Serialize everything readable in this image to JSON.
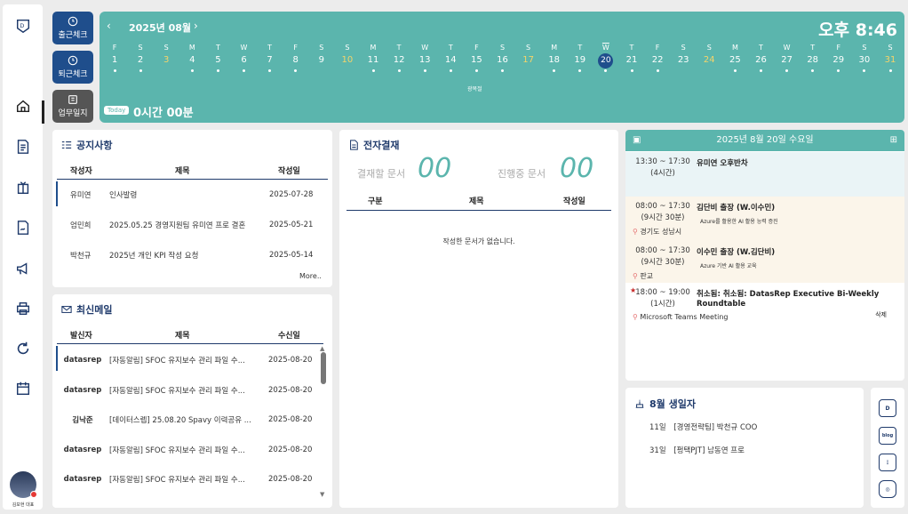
{
  "sidebar": {
    "icons": [
      "logo-icon",
      "home-icon",
      "document-icon",
      "gift-icon",
      "signature-icon",
      "megaphone-icon",
      "printer-icon",
      "refresh-icon",
      "calendar-icon"
    ],
    "user_name": "김보현 대표"
  },
  "buttons": {
    "clock_in": "출근체크",
    "clock_out": "퇴근체크",
    "work_log": "업무일지"
  },
  "calendar": {
    "month_label": "2025년 08월",
    "time": "오후 8:46",
    "today_badge": "Today",
    "today_hours": "0시간 00분",
    "holiday_label": "광복절",
    "days": [
      {
        "dow": "F",
        "num": "1",
        "dot": true
      },
      {
        "dow": "S",
        "num": "2",
        "dot": true
      },
      {
        "dow": "S",
        "num": "3",
        "dot": false,
        "weekend": true
      },
      {
        "dow": "M",
        "num": "4",
        "dot": true
      },
      {
        "dow": "T",
        "num": "5",
        "dot": true
      },
      {
        "dow": "W",
        "num": "6",
        "dot": true
      },
      {
        "dow": "T",
        "num": "7",
        "dot": true
      },
      {
        "dow": "F",
        "num": "8",
        "dot": true
      },
      {
        "dow": "S",
        "num": "9",
        "dot": false
      },
      {
        "dow": "S",
        "num": "10",
        "dot": false,
        "weekend": true
      },
      {
        "dow": "M",
        "num": "11",
        "dot": true
      },
      {
        "dow": "T",
        "num": "12",
        "dot": true
      },
      {
        "dow": "W",
        "num": "13",
        "dot": true
      },
      {
        "dow": "T",
        "num": "14",
        "dot": true
      },
      {
        "dow": "F",
        "num": "15",
        "dot": true
      },
      {
        "dow": "S",
        "num": "16",
        "dot": true
      },
      {
        "dow": "S",
        "num": "17",
        "dot": false,
        "weekend": true
      },
      {
        "dow": "M",
        "num": "18",
        "dot": true
      },
      {
        "dow": "T",
        "num": "19",
        "dot": true
      },
      {
        "dow": "W",
        "num": "20",
        "dot": true,
        "today": true
      },
      {
        "dow": "T",
        "num": "21",
        "dot": true
      },
      {
        "dow": "F",
        "num": "22",
        "dot": true
      },
      {
        "dow": "S",
        "num": "23",
        "dot": false
      },
      {
        "dow": "S",
        "num": "24",
        "dot": false,
        "weekend": true
      },
      {
        "dow": "M",
        "num": "25",
        "dot": true
      },
      {
        "dow": "T",
        "num": "26",
        "dot": true
      },
      {
        "dow": "W",
        "num": "27",
        "dot": true
      },
      {
        "dow": "T",
        "num": "28",
        "dot": true
      },
      {
        "dow": "F",
        "num": "29",
        "dot": true
      },
      {
        "dow": "S",
        "num": "30",
        "dot": true
      },
      {
        "dow": "S",
        "num": "31",
        "dot": true,
        "weekend": true
      }
    ]
  },
  "notice": {
    "title": "공지사항",
    "headers": [
      "작성자",
      "제목",
      "작성일"
    ],
    "rows": [
      {
        "author": "유미연",
        "subject": "인사발령",
        "date": "2025-07-28"
      },
      {
        "author": "엄민희",
        "subject": "2025.05.25 경영지원팀 유미연 프로 결혼",
        "date": "2025-05-21"
      },
      {
        "author": "박천규",
        "subject": "2025년 개인 KPI 작성 요청",
        "date": "2025-05-14"
      }
    ],
    "more": "More.."
  },
  "mail": {
    "title": "최신메일",
    "headers": [
      "발신자",
      "제목",
      "수신일"
    ],
    "rows": [
      {
        "sender": "datasrep",
        "subject": "[자동알림] SFOC 유지보수 관리 파일 수...",
        "date": "2025-08-20"
      },
      {
        "sender": "datasrep",
        "subject": "[자동알림] SFOC 유지보수 관리 파일 수...",
        "date": "2025-08-20"
      },
      {
        "sender": "김낙준",
        "subject": "[데이터스렙] 25.08.20 Spavy 이력공유 ...",
        "date": "2025-08-20"
      },
      {
        "sender": "datasrep",
        "subject": "[자동알림] SFOC 유지보수 관리 파일 수...",
        "date": "2025-08-20"
      },
      {
        "sender": "datasrep",
        "subject": "[자동알림] SFOC 유지보수 관리 파일 수...",
        "date": "2025-08-20"
      }
    ]
  },
  "approval": {
    "title": "전자결재",
    "pending_label": "결재할 문서",
    "pending_count": "00",
    "progress_label": "진행중 문서",
    "progress_count": "00",
    "headers": [
      "구분",
      "제목",
      "작성일"
    ],
    "empty": "작성한 문서가 없습니다."
  },
  "schedule": {
    "date": "2025년 8월 20일 수요일",
    "items": [
      {
        "time": "13:30 ~ 17:30",
        "duration": "(4시간)",
        "title": "유미연 오후반차",
        "sub": "",
        "loc": ""
      },
      {
        "time": "08:00 ~ 17:30",
        "duration": "(9시간 30분)",
        "title": "김단비 출장 (W.이수민)",
        "sub": "Azure를 활용한 AI 활용 능력 증진",
        "loc": "경기도 성남시"
      },
      {
        "time": "08:00 ~ 17:30",
        "duration": "(9시간 30분)",
        "title": "이수민 출장 (W.김단비)",
        "sub": "Azure 기반 AI 활용 교육",
        "loc": "판교"
      },
      {
        "time": "18:00 ~ 19:00",
        "duration": "(1시간)",
        "title": "취소됨: 취소됨: DatasRep Executive Bi-Weekly Roundtable",
        "sub": "",
        "loc": "Microsoft Teams Meeting",
        "action": "삭제"
      }
    ]
  },
  "birthday": {
    "title": "8월 생일자",
    "rows": [
      {
        "day": "11일",
        "text": "[경영전략팀] 박천규 COO"
      },
      {
        "day": "31일",
        "text": "[펑택PJT] 남동연 프로"
      }
    ]
  },
  "sns": [
    "logo-icon",
    "blog",
    "chat-icon",
    "instagram-icon"
  ],
  "colors": {
    "accent": "#5bb5ad",
    "navy": "#1f3a6b",
    "btn_blue": "#1f4e8c",
    "btn_gray": "#555555"
  }
}
